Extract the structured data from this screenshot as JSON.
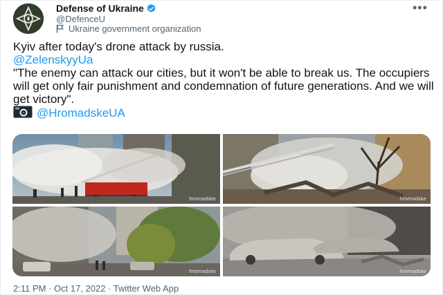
{
  "account": {
    "display_name": "Defense of Ukraine",
    "handle": "@DefenceU",
    "label": "Ukraine government organization"
  },
  "tweet": {
    "line1": "Kyiv after today's drone attack by russia.",
    "mention1": "@ZelenskyyUa",
    "quote": "\"The enemy can attack our cities, but it won't be able to break us. The occupiers will get only fair punishment and condemnation of future generations. And we will get victory\".",
    "camera_icon": "camera-icon",
    "mention2": "@HromadskeUA"
  },
  "media": {
    "watermarks": [
      "hromadske",
      "hromadske",
      "hromadske",
      "hromadske"
    ]
  },
  "meta": {
    "timestamp": "2:11 PM · Oct 17, 2022 · Twitter Web App"
  },
  "colors": {
    "link": "#1d9bf0",
    "text": "#0f1419",
    "secondary": "#536471",
    "verified": "#1d9bf0"
  },
  "icons": [
    "avatar-emblem",
    "verified-badge-icon",
    "government-flag-icon",
    "more-options-icon",
    "camera-icon"
  ]
}
